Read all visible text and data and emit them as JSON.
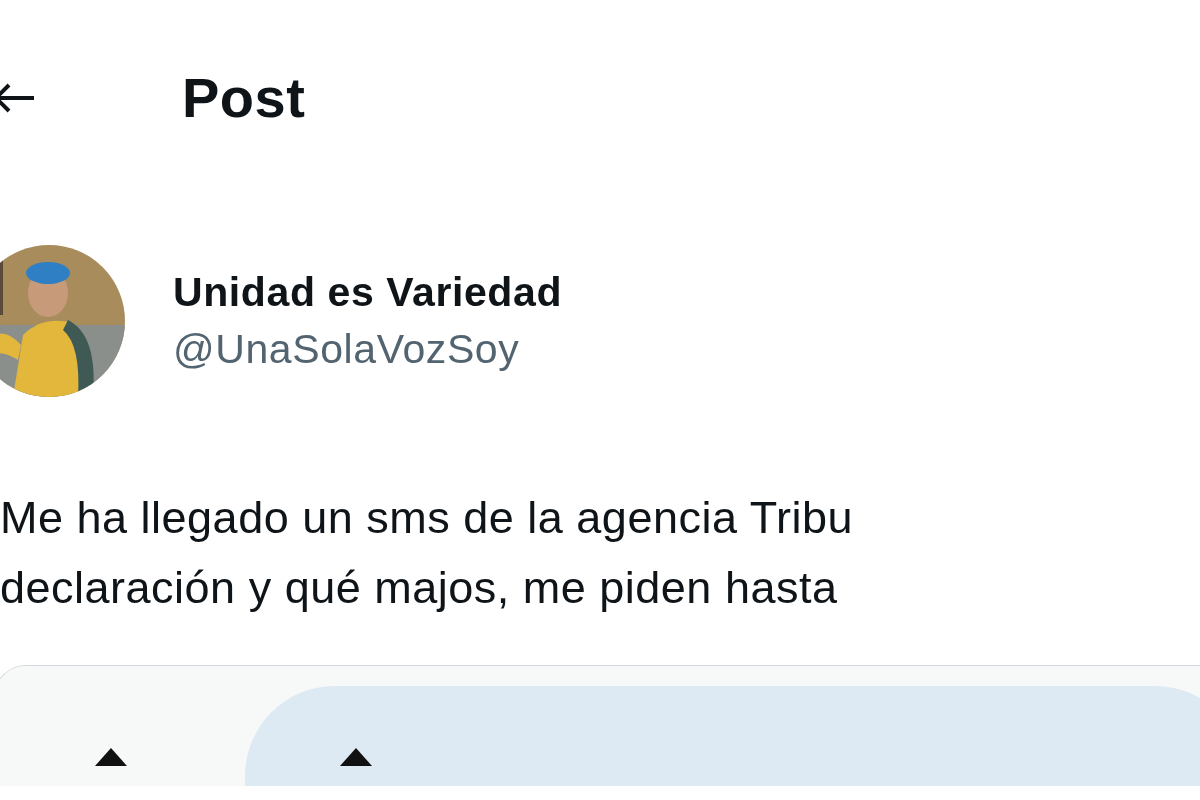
{
  "header": {
    "title": "Post"
  },
  "post": {
    "author": {
      "name": "Unidad es Variedad",
      "handle": "@UnaSolaVozSoy"
    },
    "text_lines": [
      "Me ha llegado un sms de la agencia Tribu",
      "declaración y qué majos, me piden hasta"
    ]
  }
}
